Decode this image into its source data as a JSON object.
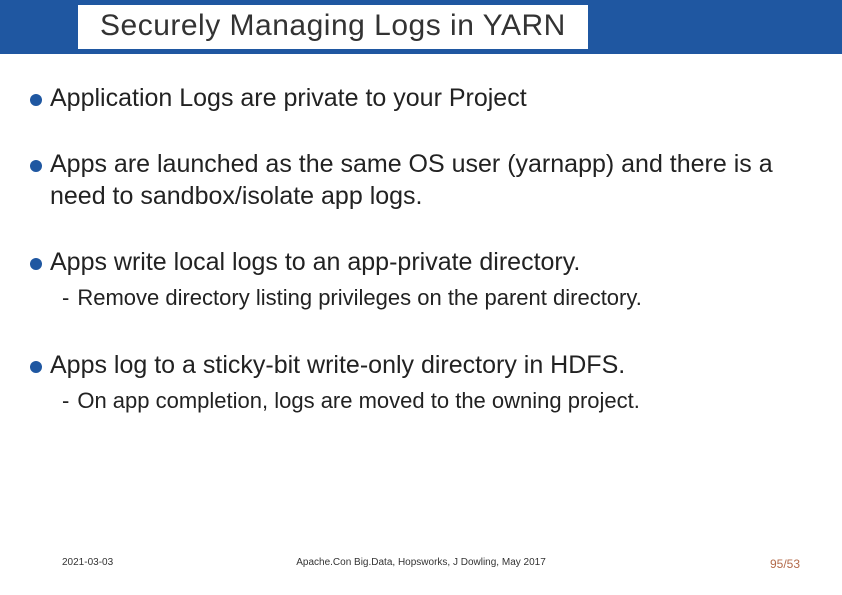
{
  "title": "Securely Managing Logs in YARN",
  "bullets": [
    {
      "text": "Application Logs are private to your Project",
      "sub": null
    },
    {
      "text": "Apps are launched as the same OS user (yarnapp) and there is a need to sandbox/isolate app logs.",
      "sub": null
    },
    {
      "text": "Apps write local logs to an app-private directory.",
      "sub": "Remove directory listing privileges on the parent directory."
    },
    {
      "text": "Apps log to a sticky-bit write-only directory in HDFS.",
      "sub": "On app completion, logs are moved to the owning project."
    }
  ],
  "footer": {
    "date": "2021-03-03",
    "center": "Apache.Con Big.Data, Hopsworks, J Dowling, May 2017",
    "page": "95/53"
  }
}
